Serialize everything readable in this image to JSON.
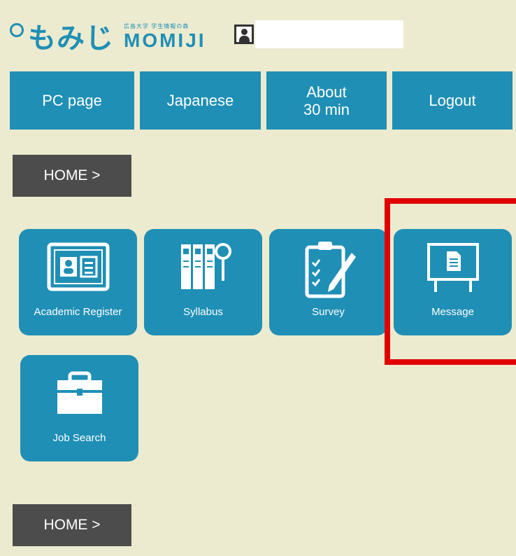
{
  "header": {
    "logo_kana": "もみじ",
    "logo_small": "広島大学 学生情報の森",
    "logo_text": "MOMIJI"
  },
  "nav": {
    "pc_page": "PC page",
    "japanese": "Japanese",
    "about_line1": "About",
    "about_line2": "30 min",
    "logout": "Logout"
  },
  "home": {
    "top_label": "HOME >",
    "bottom_label": "HOME >"
  },
  "tiles": [
    {
      "label": "Academic Register",
      "icon": "id-card-icon"
    },
    {
      "label": "Syllabus",
      "icon": "binders-magnifier-icon"
    },
    {
      "label": "Survey",
      "icon": "clipboard-pen-icon"
    },
    {
      "label": "Message",
      "icon": "message-board-icon"
    },
    {
      "label": "Job Search",
      "icon": "briefcase-icon"
    }
  ],
  "colors": {
    "accent": "#1f8fb5",
    "background": "#ecebd0",
    "home_button": "#4c4c4c",
    "highlight": "#e10000"
  }
}
